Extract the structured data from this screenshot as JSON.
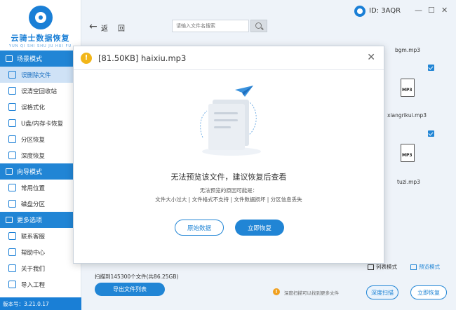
{
  "app": {
    "logo_title": "云骑士数据恢复",
    "logo_subtitle": "YUN QI SHI SHU JU HUI FU",
    "version": "版本号：3.21.0.17",
    "user_id": "ID: 3AQR",
    "window_controls": {
      "minimize": "—",
      "maximize": "☐",
      "close": "✕"
    }
  },
  "sidebar": {
    "sections": [
      {
        "title": "场景模式",
        "items": [
          {
            "label": "误删除文件",
            "active": true
          },
          {
            "label": "误清空回收站"
          },
          {
            "label": "误格式化"
          },
          {
            "label": "U盘/内存卡恢复"
          },
          {
            "label": "分区恢复"
          },
          {
            "label": "深度恢复"
          }
        ]
      },
      {
        "title": "向导模式",
        "items": [
          {
            "label": "常用位置"
          },
          {
            "label": "磁盘分区"
          }
        ]
      },
      {
        "title": "更多选项",
        "items": [
          {
            "label": "联系客服"
          },
          {
            "label": "帮助中心"
          },
          {
            "label": "关于我们"
          },
          {
            "label": "导入工程"
          }
        ]
      }
    ]
  },
  "toolbar": {
    "back_label": "返",
    "home_label": "回",
    "search_placeholder": "请输入文件名搜索"
  },
  "files": [
    {
      "name": "bgm.mp3"
    },
    {
      "name": "xiangrikui.mp3"
    },
    {
      "name": "tuzi.mp3"
    }
  ],
  "file_type_label": "MP3",
  "footer": {
    "scan_info": "扫描到145300个文件(共86.25GB)",
    "export_label": "导出文件列表",
    "tip_text": "深度扫描可以找到更多文件",
    "deep_scan_label": "深度扫描",
    "recover_label": "立即恢复",
    "list_view_label": "列表模式",
    "grid_view_label": "预览模式"
  },
  "modal": {
    "title": "[81.50KB] haixiu.mp3",
    "message": "无法预览该文件，建议恢复后查看",
    "reason_title": "无法预览的原因可能是：",
    "reasons": "文件大小过大 | 文件格式不支持 | 文件数据损坏 | 分区信息丢失",
    "raw_data_label": "原始数据",
    "recover_now_label": "立即恢复"
  },
  "colors": {
    "primary": "#2185d5",
    "warning": "#f2b619",
    "active_bg": "#cfe2f6"
  }
}
